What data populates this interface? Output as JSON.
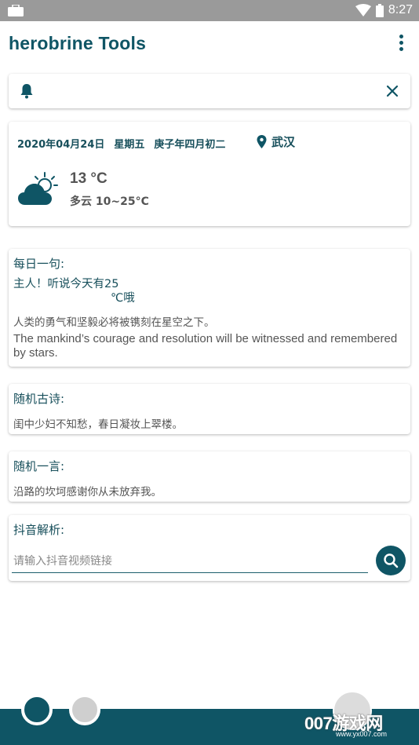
{
  "status_bar": {
    "time": "8:27"
  },
  "app": {
    "title": "herobrine Tools"
  },
  "weather": {
    "date": "2020年04月24日",
    "weekday": "星期五",
    "lunar": "庚子年四月初二",
    "location": "武汉",
    "temperature": "13 °C",
    "condition": "多云 10~25°C"
  },
  "daily_quote": {
    "title": "每日一句:",
    "greeting_line1": "主人！听说今天有25",
    "greeting_line2": "℃哦",
    "sentence_zh": "人类的勇气和坚毅必将被镌刻在星空之下。",
    "sentence_en": "The mankind’s courage and resolution will be witnessed and remembered by stars."
  },
  "poem": {
    "title": "随机古诗:",
    "text": "闺中少妇不知愁，春日凝妆上翠楼。"
  },
  "yiyan": {
    "title": "随机一言:",
    "text": "沿路的坎坷感谢你从未放弃我。"
  },
  "douyin": {
    "title": "抖音解析:",
    "placeholder": "请输入抖音视频链接"
  },
  "watermark": {
    "brand": "007游戏网",
    "url": "www.yx007.com"
  },
  "colors": {
    "primary": "#0f5565",
    "statusbar": "#9a9a9a"
  }
}
